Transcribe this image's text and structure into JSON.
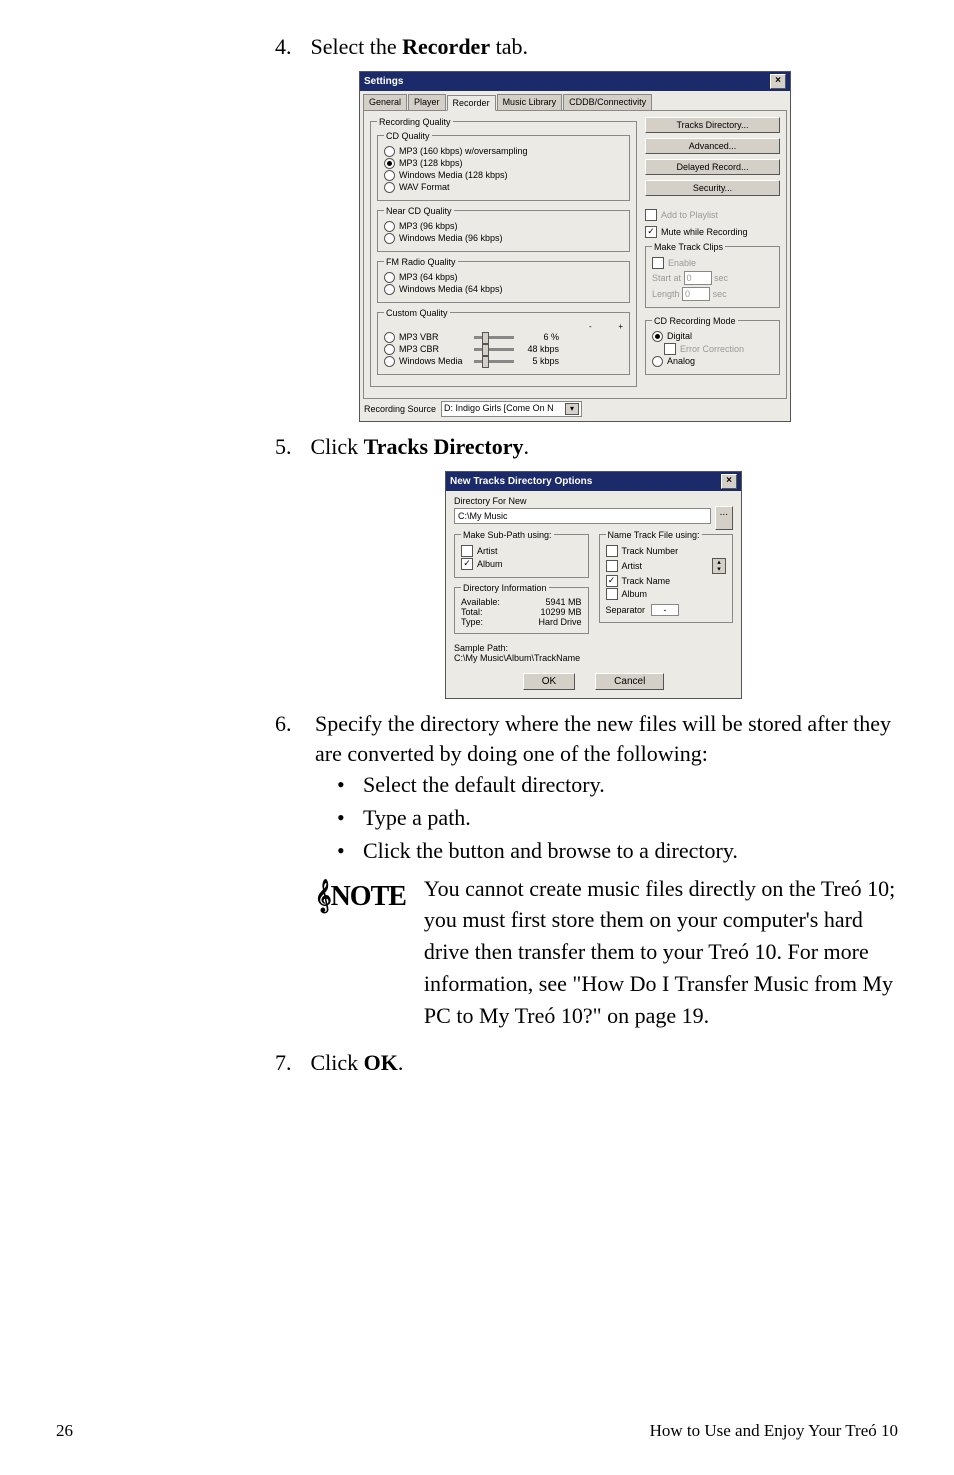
{
  "steps": {
    "s4": {
      "num": "4.",
      "text_a": "Select the ",
      "bold": "Recorder",
      "text_b": " tab."
    },
    "s5": {
      "num": "5.",
      "text_a": "Click ",
      "bold": "Tracks Directory",
      "text_b": "."
    },
    "s6": {
      "num": "6.",
      "text": "Specify the directory where the new files will be stored after they are converted by doing one of the following:"
    },
    "s7": {
      "num": "7.",
      "text_a": "Click ",
      "bold": "OK",
      "text_b": "."
    }
  },
  "bullets": [
    "Select the default directory.",
    "Type a path.",
    "Click the button and browse to a directory."
  ],
  "note": "You cannot create music files directly on the Treó 10; you must first store them on your computer's hard drive then transfer them to your Treó 10. For more information, see \"How Do I Transfer Music from My PC to My Treó 10?\" on page 19.",
  "note_label": "NOTE",
  "footer": {
    "page": "26",
    "right": "How to Use and Enjoy Your Treó 10"
  },
  "settings": {
    "title": "Settings",
    "tabs": {
      "general": "General",
      "player": "Player",
      "recorder": "Recorder",
      "library": "Music Library",
      "cddb": "CDDB/Connectivity"
    },
    "rec_quality_legend": "Recording Quality",
    "cd_quality": {
      "legend": "CD Quality",
      "opt1": "MP3 (160 kbps) w/oversampling",
      "opt2": "MP3 (128 kbps)",
      "opt3": "Windows Media (128 kbps)",
      "opt4": "WAV Format"
    },
    "near_cd": {
      "legend": "Near CD Quality",
      "opt1": "MP3 (96 kbps)",
      "opt2": "Windows Media (96 kbps)"
    },
    "fm": {
      "legend": "FM Radio Quality",
      "opt1": "MP3 (64 kbps)",
      "opt2": "Windows Media (64 kbps)"
    },
    "custom": {
      "legend": "Custom Quality",
      "opt1": "MP3 VBR",
      "val1": "6 %",
      "opt2": "MP3 CBR",
      "val2": "48 kbps",
      "opt3": "Windows Media",
      "val3": "5 kbps"
    },
    "rec_source_label": "Recording Source",
    "rec_source_value": "D: Indigo Girls [Come On N",
    "buttons": {
      "tracks_dir": "Tracks Directory...",
      "advanced": "Advanced...",
      "delayed": "Delayed Record...",
      "security": "Security..."
    },
    "add_playlist": "Add to Playlist",
    "mute": "Mute while Recording",
    "clips": {
      "legend": "Make Track Clips",
      "enable": "Enable",
      "start": "Start at",
      "start_val": "0",
      "unit1": "sec",
      "length": "Length",
      "length_val": "0",
      "unit2": "sec"
    },
    "cdmode": {
      "legend": "CD Recording Mode",
      "digital": "Digital",
      "error": "Error Correction",
      "analog": "Analog"
    }
  },
  "dirdlg": {
    "title": "New Tracks Directory Options",
    "dir_for_new": "Directory For New",
    "path": "C:\\My Music",
    "browse": "...",
    "subpath": {
      "legend": "Make Sub-Path using:",
      "artist": "Artist",
      "album": "Album"
    },
    "nametrack": {
      "legend": "Name Track File using:",
      "number": "Track Number",
      "artist": "Artist",
      "trackname": "Track Name",
      "album": "Album",
      "separator": "Separator",
      "sep_val": "-"
    },
    "dirinfo": {
      "legend": "Directory Information",
      "avail": "Available:",
      "avail_v": "5941 MB",
      "total": "Total:",
      "total_v": "10299 MB",
      "type": "Type:",
      "type_v": "Hard Drive"
    },
    "sample_label": "Sample Path:",
    "sample": "C:\\My Music\\Album\\TrackName",
    "ok": "OK",
    "cancel": "Cancel"
  }
}
